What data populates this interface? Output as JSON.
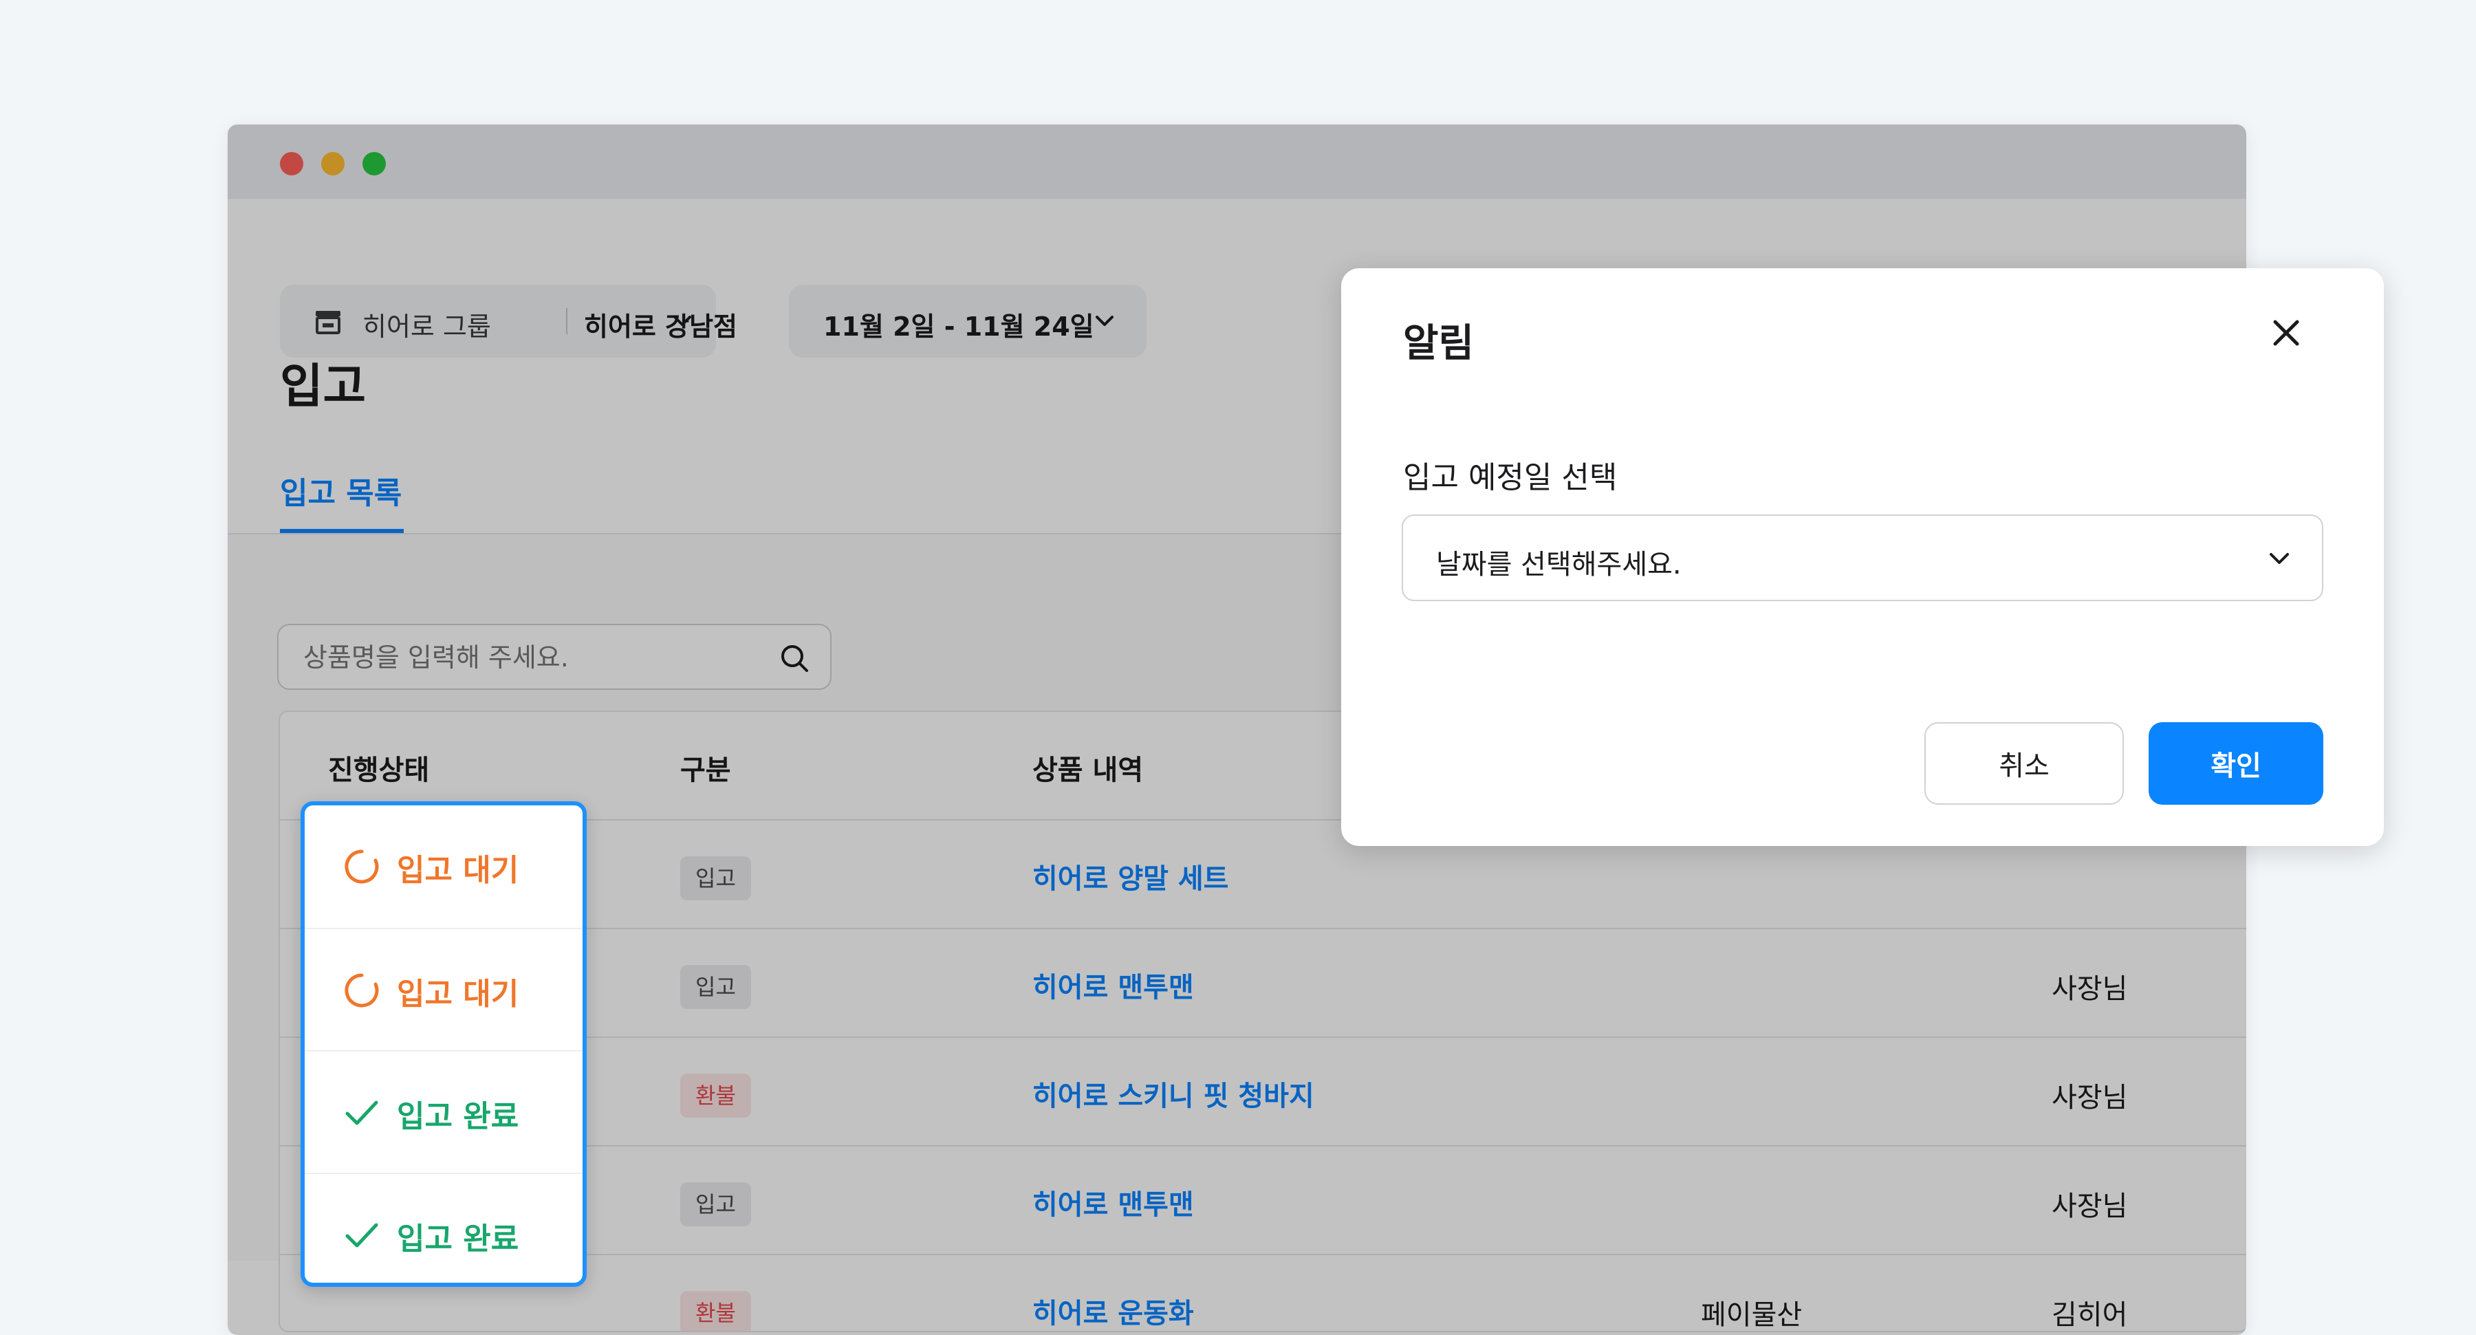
{
  "header": {
    "store_group": "히어로 그룹",
    "store_name": "히어로 강남점",
    "date_range": "11월 2일 - 11월 24일"
  },
  "page": {
    "title": "입고",
    "tab": "입고 목록"
  },
  "search": {
    "placeholder": "상품명을 입력해 주세요."
  },
  "table": {
    "columns": [
      "진행상태",
      "구분",
      "상품 내역"
    ],
    "rows": [
      {
        "type": "입고",
        "product": "히어로 양말 세트",
        "supplier": "",
        "manager": ""
      },
      {
        "type": "입고",
        "product": "히어로 맨투맨",
        "supplier": "",
        "manager": "사장님"
      },
      {
        "type": "환불",
        "product": "히어로 스키니 핏 청바지",
        "supplier": "",
        "manager": "사장님"
      },
      {
        "type": "입고",
        "product": "히어로 맨투맨",
        "supplier": "",
        "manager": "사장님"
      },
      {
        "type": "환불",
        "product": "히어로 운동화",
        "supplier": "페이물산",
        "manager": "김히어"
      }
    ]
  },
  "status_popover": {
    "items": [
      {
        "label": "입고 대기",
        "icon": "loading-icon"
      },
      {
        "label": "입고 대기",
        "icon": "loading-icon"
      },
      {
        "label": "입고 완료",
        "icon": "check-icon"
      },
      {
        "label": "입고 완료",
        "icon": "check-icon"
      }
    ]
  },
  "modal": {
    "title": "알림",
    "field_label": "입고 예정일 선택",
    "select_value": "날짜를 선택해주세요.",
    "cancel": "취소",
    "confirm": "확인"
  },
  "colors": {
    "accent": "#0a84ff",
    "waiting": "#f0762a",
    "done": "#18a66b",
    "refund": "#e5484d"
  }
}
